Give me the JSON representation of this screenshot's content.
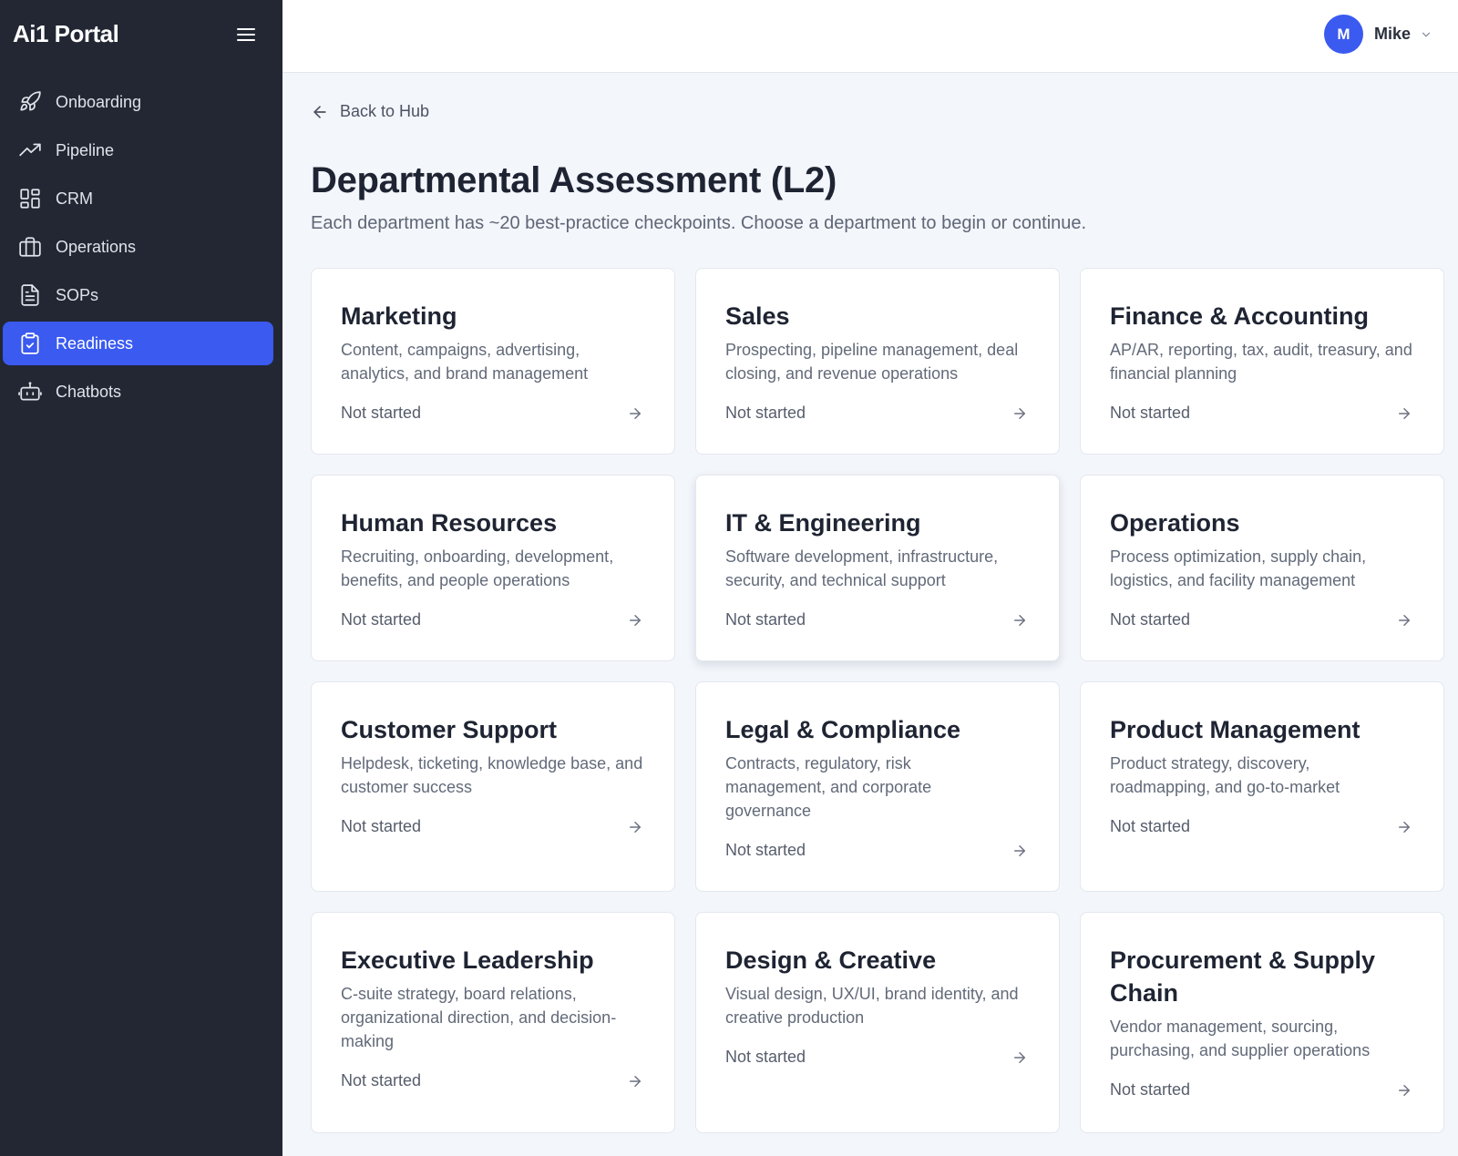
{
  "app": {
    "brand": "Ai1 Portal"
  },
  "sidebar": {
    "items": [
      {
        "label": "Onboarding",
        "icon": "rocket-icon",
        "active": false
      },
      {
        "label": "Pipeline",
        "icon": "trending-up-icon",
        "active": false
      },
      {
        "label": "CRM",
        "icon": "dashboard-icon",
        "active": false
      },
      {
        "label": "Operations",
        "icon": "briefcase-icon",
        "active": false
      },
      {
        "label": "SOPs",
        "icon": "document-icon",
        "active": false
      },
      {
        "label": "Readiness",
        "icon": "clipboard-check-icon",
        "active": true
      },
      {
        "label": "Chatbots",
        "icon": "bot-icon",
        "active": false
      }
    ]
  },
  "header": {
    "user": {
      "initial": "M",
      "name": "Mike"
    }
  },
  "main": {
    "back_label": "Back to Hub",
    "title": "Departmental Assessment (L2)",
    "subtitle": "Each department has ~20 best-practice checkpoints. Choose a department to begin or continue.",
    "departments": [
      {
        "title": "Marketing",
        "desc": "Content, campaigns, advertising, analytics, and brand management",
        "status": "Not started"
      },
      {
        "title": "Sales",
        "desc": "Prospecting, pipeline management, deal closing, and revenue operations",
        "status": "Not started"
      },
      {
        "title": "Finance & Accounting",
        "desc": "AP/AR, reporting, tax, audit, treasury, and financial planning",
        "status": "Not started"
      },
      {
        "title": "Human Resources",
        "desc": "Recruiting, onboarding, development, benefits, and people operations",
        "status": "Not started"
      },
      {
        "title": "IT & Engineering",
        "desc": "Software development, infrastructure, security, and technical support",
        "status": "Not started"
      },
      {
        "title": "Operations",
        "desc": "Process optimization, supply chain, logistics, and facility management",
        "status": "Not started"
      },
      {
        "title": "Customer Support",
        "desc": "Helpdesk, ticketing, knowledge base, and customer success",
        "status": "Not started"
      },
      {
        "title": "Legal & Compliance",
        "desc": "Contracts, regulatory, risk management, and corporate governance",
        "status": "Not started"
      },
      {
        "title": "Product Management",
        "desc": "Product strategy, discovery, roadmapping, and go-to-market",
        "status": "Not started"
      },
      {
        "title": "Executive Leadership",
        "desc": "C-suite strategy, board relations, organizational direction, and decision-making",
        "status": "Not started"
      },
      {
        "title": "Design & Creative",
        "desc": "Visual design, UX/UI, brand identity, and creative production",
        "status": "Not started"
      },
      {
        "title": "Procurement & Supply Chain",
        "desc": "Vendor management, sourcing, purchasing, and supplier operations",
        "status": "Not started"
      }
    ]
  },
  "colors": {
    "sidebar_bg": "#222733",
    "accent": "#3a5af0",
    "page_bg": "#f3f6fb"
  }
}
